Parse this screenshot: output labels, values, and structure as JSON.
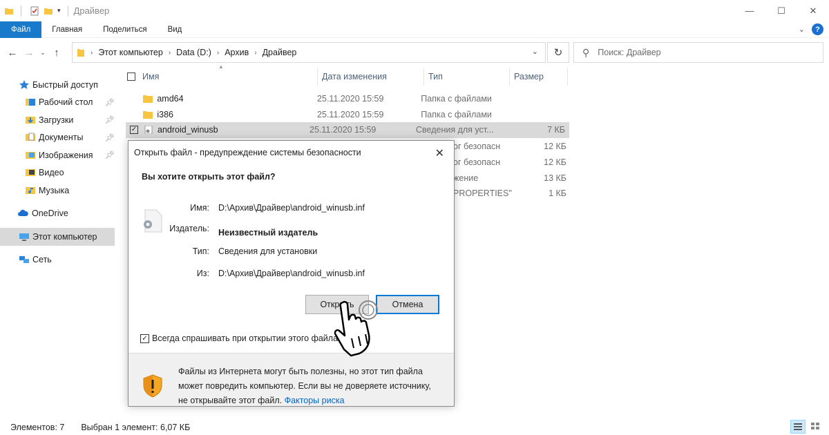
{
  "window": {
    "title": "Драйвер",
    "controls": [
      "—",
      "☐",
      "✕"
    ]
  },
  "ribbon": {
    "tabs": [
      "Файл",
      "Главная",
      "Поделиться",
      "Вид"
    ]
  },
  "address": {
    "path": [
      "Этот компьютер",
      "Data (D:)",
      "Архив",
      "Драйвер"
    ],
    "search_placeholder": "Поиск: Драйвер"
  },
  "nav": {
    "quick_access": "Быстрый доступ",
    "quick_items": [
      "Рабочий стол",
      "Загрузки",
      "Документы",
      "Изображения",
      "Видео",
      "Музыка"
    ],
    "onedrive": "OneDrive",
    "this_pc": "Этот компьютер",
    "network": "Сеть"
  },
  "columns": {
    "name": "Имя",
    "date": "Дата изменения",
    "type": "Тип",
    "size": "Размер"
  },
  "files": [
    {
      "name": "amd64",
      "date": "25.11.2020 15:59",
      "type": "Папка с файлами",
      "size": ""
    },
    {
      "name": "i386",
      "date": "25.11.2020 15:59",
      "type": "Папка с файлами",
      "size": ""
    },
    {
      "name": "android_winusb",
      "date": "25.11.2020 15:59",
      "type": "Сведения для уст...",
      "size": "7 КБ"
    }
  ],
  "hidden_rows": [
    {
      "type_fragment": "ог безопасн",
      "size": "12 КБ"
    },
    {
      "type_fragment": "ог безопасн",
      "size": "12 КБ"
    },
    {
      "type_fragment": "жение",
      "size": "13 КБ"
    },
    {
      "type_fragment": "PROPERTIES\"",
      "size": "1 КБ"
    }
  ],
  "status": {
    "count": "Элементов: 7",
    "selected": "Выбран 1 элемент: 6,07 КБ"
  },
  "dialog": {
    "title": "Открыть файл - предупреждение системы безопасности",
    "question": "Вы хотите открыть этот файл?",
    "name_label": "Имя:",
    "name_value": "D:\\Архив\\Драйвер\\android_winusb.inf",
    "publisher_label": "Издатель:",
    "publisher_value": "Неизвестный издатель",
    "type_label": "Тип:",
    "type_value": "Сведения для установки",
    "from_label": "Из:",
    "from_value": "D:\\Архив\\Драйвер\\android_winusb.inf",
    "open_button": "Открыть",
    "cancel_button": "Отмена",
    "always_ask": "Всегда спрашивать при открытии этого файла",
    "warning_line1": "Файлы из Интернета могут быть полезны, но этот тип файла",
    "warning_line2": "может повредить компьютер. Если вы не доверяете источнику,",
    "warning_line3": "не открывайте этот файл.",
    "risk_link": "Факторы риска"
  },
  "colors": {
    "accent": "#1979ca",
    "folder": "#f8c542",
    "selection": "#d9d9d9",
    "link": "#0066cc"
  }
}
